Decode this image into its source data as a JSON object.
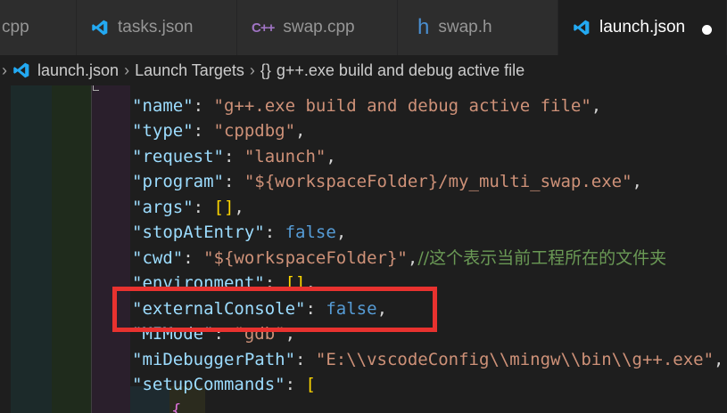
{
  "tabs": [
    {
      "label": "cpp",
      "icon": "vscode-icon"
    },
    {
      "label": "tasks.json",
      "icon": "vscode-icon"
    },
    {
      "label": "swap.cpp",
      "icon": "cpp-icon"
    },
    {
      "label": "swap.h",
      "icon": "h-icon",
      "icon_text": "h"
    },
    {
      "label": "launch.json",
      "icon": "vscode-icon",
      "active": true,
      "modified": true
    }
  ],
  "breadcrumb": {
    "file": "launch.json",
    "section": "Launch Targets",
    "braces": "{}",
    "item": "g++.exe build and debug active file"
  },
  "code": {
    "name_key": "\"name\"",
    "name_val": "\"g++.exe build and debug active file\"",
    "type_key": "\"type\"",
    "type_val": "\"cppdbg\"",
    "request_key": "\"request\"",
    "request_val": "\"launch\"",
    "program_key": "\"program\"",
    "program_val": "\"${workspaceFolder}/my_multi_swap.exe\"",
    "args_key": "\"args\"",
    "args_val": "[]",
    "stop_key": "\"stopAtEntry\"",
    "stop_val": "false",
    "cwd_key": "\"cwd\"",
    "cwd_val": "\"${workspaceFolder}\"",
    "cwd_comment": "//这个表示当前工程所在的文件夹",
    "env_key": "\"environment\"",
    "env_val": "[]",
    "ext_key": "\"externalConsole\"",
    "ext_val": "false",
    "mimode_key": "\"MIMode\"",
    "mimode_val": "\"gdb\"",
    "midebug_key": "\"miDebuggerPath\"",
    "midebug_val": "\"E:\\\\vscodeConfig\\\\mingw\\\\bin\\\\g++.exe\"",
    "setup_key": "\"setupCommands\"",
    "setup_val": "[",
    "open_brace": "{"
  },
  "colors": {
    "highlight_border": "#e8322f",
    "vscode_icon": "#23a9f2"
  }
}
